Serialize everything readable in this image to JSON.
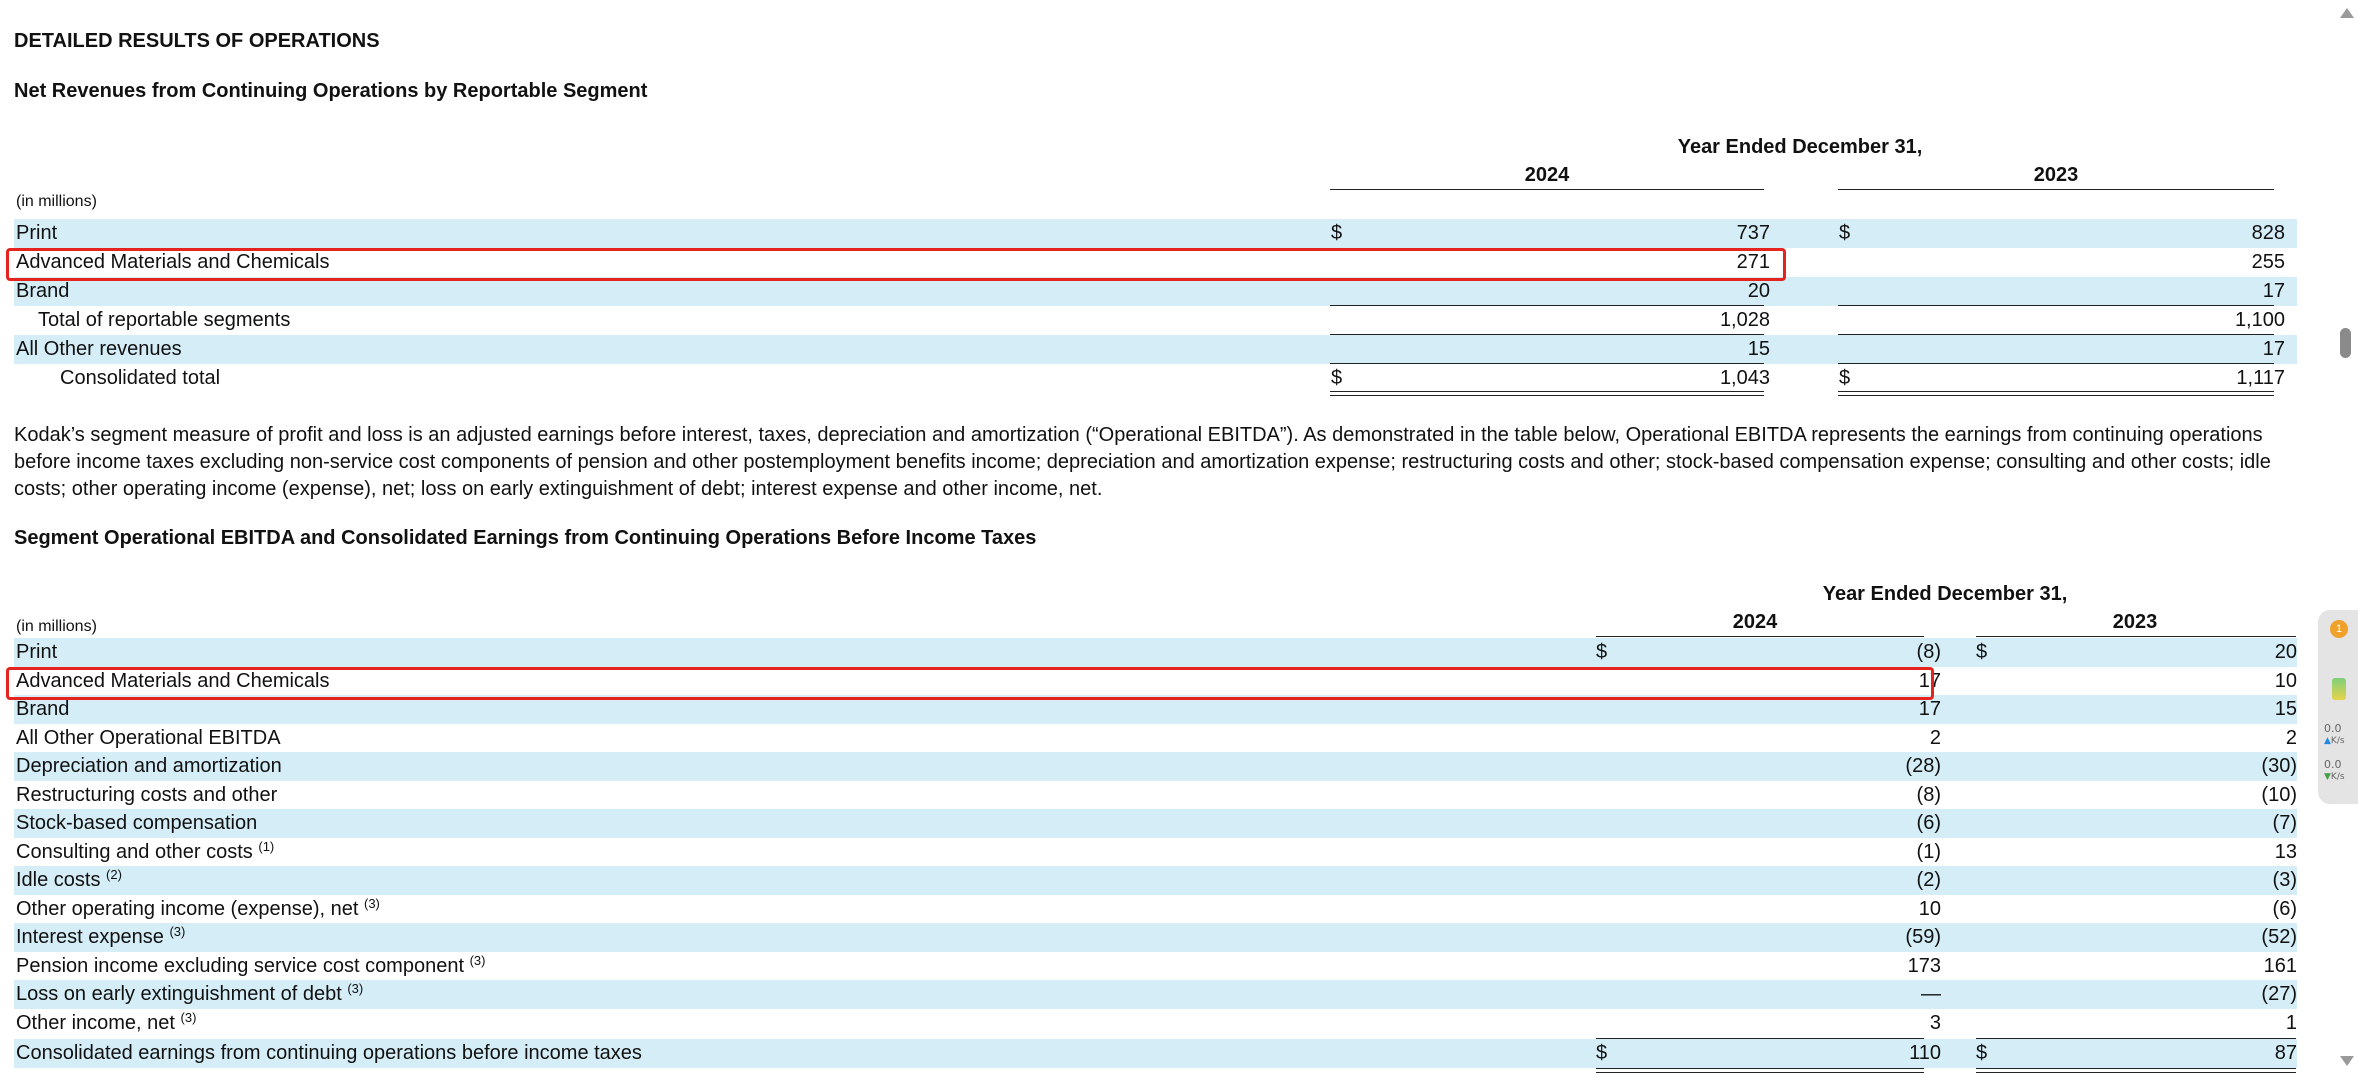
{
  "headings": {
    "main": "DETAILED RESULTS OF OPERATIONS",
    "table1": "Net Revenues from Continuing Operations by Reportable Segment",
    "table2": "Segment Operational EBITDA and Consolidated Earnings from Continuing Operations Before Income Taxes"
  },
  "table1": {
    "period": "Year Ended December 31,",
    "year1": "2024",
    "year2": "2023",
    "units": "(in millions)",
    "currency": "$",
    "rows": [
      {
        "label": "Print",
        "v1": "737",
        "v2": "828"
      },
      {
        "label": "Advanced Materials and Chemicals",
        "v1": "271",
        "v2": "255"
      },
      {
        "label": "Brand",
        "v1": "20",
        "v2": "17"
      },
      {
        "label": "Total of reportable segments",
        "v1": "1,028",
        "v2": "1,100"
      },
      {
        "label": "All Other revenues",
        "v1": "15",
        "v2": "17"
      },
      {
        "label": "Consolidated total",
        "v1": "1,043",
        "v2": "1,117"
      }
    ]
  },
  "paragraph": "Kodak’s segment measure of profit and loss is an adjusted earnings before interest, taxes, depreciation and amortization (“Operational EBITDA”). As demonstrated in the table below, Operational EBITDA represents the earnings from continuing operations before income taxes excluding non-service cost components of pension and other postemployment benefits income; depreciation and amortization expense; restructuring costs and other; stock-based compensation expense; consulting and other costs; idle costs; other operating income (expense), net; loss on early extinguishment of debt; interest expense and other income, net.",
  "table2": {
    "period": "Year Ended December 31,",
    "year1": "2024",
    "year2": "2023",
    "units": "(in millions)",
    "currency": "$",
    "rows": [
      {
        "label": "Print",
        "v1": "(8)",
        "v2": "20"
      },
      {
        "label": "Advanced Materials and Chemicals",
        "v1": "17",
        "v2": "10"
      },
      {
        "label": "Brand",
        "v1": "17",
        "v2": "15"
      },
      {
        "label": "All Other Operational EBITDA",
        "v1": "2",
        "v2": "2"
      },
      {
        "label": "Depreciation and amortization",
        "v1": "(28)",
        "v2": "(30)"
      },
      {
        "label": "Restructuring costs and other",
        "v1": "(8)",
        "v2": "(10)"
      },
      {
        "label": "Stock-based compensation",
        "v1": "(6)",
        "v2": "(7)"
      },
      {
        "label": "Consulting and other costs",
        "note": "(1)",
        "v1": "(1)",
        "v2": "13"
      },
      {
        "label": "Idle costs",
        "note": "(2)",
        "v1": "(2)",
        "v2": "(3)"
      },
      {
        "label": "Other operating income (expense), net",
        "note": "(3)",
        "v1": "10",
        "v2": "(6)"
      },
      {
        "label": "Interest expense",
        "note": "(3)",
        "v1": "(59)",
        "v2": "(52)"
      },
      {
        "label": "Pension income excluding service cost component",
        "note": "(3)",
        "v1": "173",
        "v2": "161"
      },
      {
        "label": "Loss on early extinguishment of debt",
        "note": "(3)",
        "v1": "—",
        "v2": "(27)"
      },
      {
        "label": "Other income, net",
        "note": "(3)",
        "v1": "3",
        "v2": "1"
      },
      {
        "label": "Consolidated earnings from continuing operations before income taxes",
        "v1": "110",
        "v2": "87"
      }
    ]
  },
  "widget": {
    "badge": "1",
    "upload_speed": "0.0",
    "upload_unit": "K/s",
    "download_speed": "0.0",
    "download_unit": "K/s"
  },
  "colors": {
    "row_shade": "#d4edf7",
    "highlight": "#e5231f"
  }
}
